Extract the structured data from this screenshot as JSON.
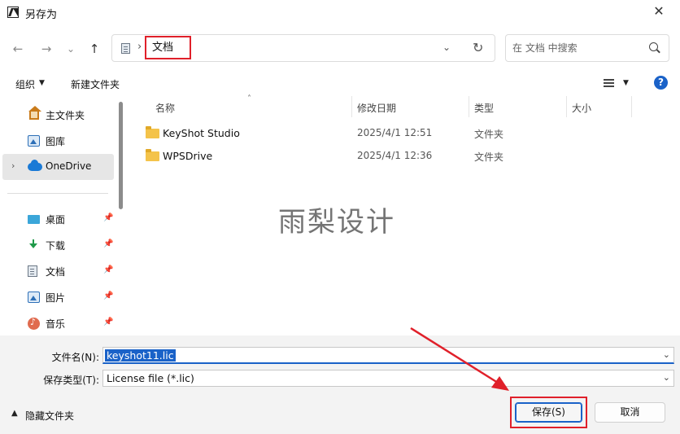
{
  "window": {
    "title": "另存为",
    "close_symbol": "✕"
  },
  "nav": {
    "back": "←",
    "forward": "→",
    "recent": "⌄",
    "up": "↑"
  },
  "address": {
    "separator": "›",
    "crumb": "文档",
    "dropdown": "⌄",
    "refresh": "↻"
  },
  "search": {
    "placeholder": "在 文档 中搜索"
  },
  "toolbar": {
    "organize_label": "组织",
    "organize_caret": "▼",
    "new_folder_label": "新建文件夹",
    "view_caret": "▼",
    "help_symbol": "?"
  },
  "sidebar": {
    "items": [
      {
        "label": "主文件夹",
        "icon": "home-icon",
        "pinned": false,
        "expandable": false
      },
      {
        "label": "图库",
        "icon": "gallery-icon",
        "pinned": false,
        "expandable": false
      },
      {
        "label": "OneDrive",
        "icon": "cloud-icon",
        "pinned": false,
        "expandable": true,
        "selected": true
      },
      {
        "label": "桌面",
        "icon": "desktop-icon",
        "pinned": true
      },
      {
        "label": "下载",
        "icon": "download-icon",
        "pinned": true
      },
      {
        "label": "文档",
        "icon": "documents-icon",
        "pinned": true
      },
      {
        "label": "图片",
        "icon": "pictures-icon",
        "pinned": true
      },
      {
        "label": "音乐",
        "icon": "music-icon",
        "pinned": true
      }
    ],
    "chevron": "›",
    "pin_symbol": "📌"
  },
  "file_list": {
    "columns": {
      "name": "名称",
      "modified": "修改日期",
      "type": "类型",
      "size": "大小"
    },
    "sort_caret": "˄",
    "rows": [
      {
        "name": "KeyShot Studio",
        "modified": "2025/4/1 12:51",
        "type": "文件夹"
      },
      {
        "name": "WPSDrive",
        "modified": "2025/4/1 12:36",
        "type": "文件夹"
      }
    ]
  },
  "watermark": "雨梨设计",
  "form": {
    "filename_label": "文件名(N):",
    "filename_value": "keyshot11.lic",
    "filetype_label": "保存类型(T):",
    "filetype_value": "License file (*.lic)",
    "dropdown_caret": "⌄"
  },
  "footer": {
    "hide_folders_caret": "▲",
    "hide_folders_label": "隐藏文件夹",
    "save_label": "保存(S)",
    "cancel_label": "取消"
  },
  "colors": {
    "accent": "#1a62c8",
    "highlight_red": "#e0202a",
    "folder": "#f4c34a"
  }
}
